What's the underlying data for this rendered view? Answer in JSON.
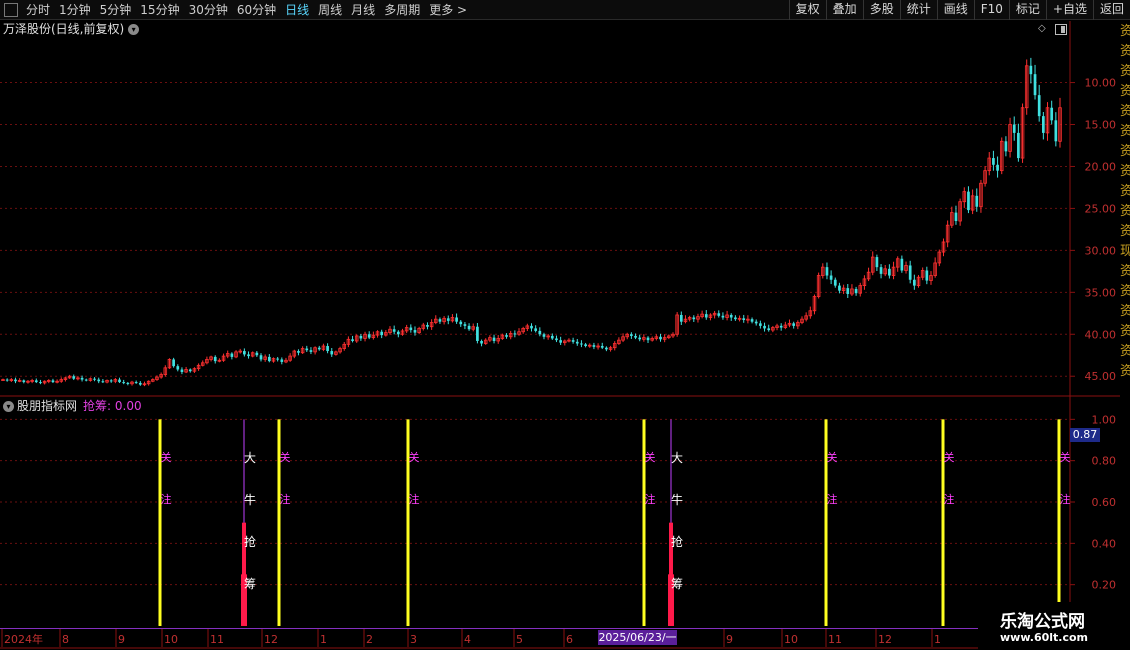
{
  "toolbar": {
    "periods": [
      "分时",
      "1分钟",
      "5分钟",
      "15分钟",
      "30分钟",
      "60分钟",
      "日线",
      "周线",
      "月线",
      "多周期",
      "更多 >"
    ],
    "active_period": "日线",
    "right_tools": [
      "复权",
      "叠加",
      "多股",
      "统计",
      "画线",
      "F10",
      "标记",
      "+自选",
      "返回"
    ]
  },
  "main_chart": {
    "title": "万泽股份(日线,前复权)",
    "price_ticks": [
      "45.00",
      "40.00",
      "35.00",
      "30.00",
      "25.00",
      "20.00",
      "15.00",
      "10.00"
    ],
    "up_color": "#ff3030",
    "down_color": "#40e0e0"
  },
  "right_strip_text": "资资资资资资资资资资资现资资资资资资",
  "indicator": {
    "name": "股朋指标网",
    "value_label": "抢筹: 0.00",
    "ticks": [
      "1.00",
      "0.80",
      "0.60",
      "0.40",
      "0.20"
    ],
    "current_value": "0.87",
    "attention_labels": [
      "关",
      "注"
    ],
    "signal_labels": [
      "大",
      "牛",
      "抢",
      "筹"
    ],
    "yellow_color": "#ffff20",
    "signal_color": "#ff1a4a"
  },
  "time_axis": {
    "labels": [
      "2024年",
      "8",
      "9",
      "10",
      "11",
      "12",
      "1",
      "2",
      "3",
      "4",
      "5",
      "6",
      "9",
      "10",
      "11",
      "12",
      "1"
    ],
    "selected_date": "2025/06/23/一"
  },
  "watermark": {
    "title": "乐淘公式网",
    "url": "www.60lt.com"
  },
  "chart_data": {
    "type": "candlestick",
    "ylim": [
      8,
      49
    ],
    "y_ticks": [
      10,
      15,
      20,
      25,
      30,
      35,
      40,
      45
    ],
    "closes": [
      9.6,
      9.5,
      9.6,
      9.4,
      9.5,
      9.3,
      9.4,
      9.5,
      9.3,
      9.2,
      9.4,
      9.5,
      9.3,
      9.4,
      9.6,
      9.8,
      10.0,
      9.7,
      9.8,
      9.6,
      9.5,
      9.7,
      9.6,
      9.4,
      9.3,
      9.5,
      9.4,
      9.6,
      9.3,
      9.2,
      9.1,
      9.3,
      9.2,
      9.0,
      9.1,
      9.4,
      9.6,
      9.9,
      10.2,
      11.0,
      12.0,
      11.2,
      10.8,
      10.5,
      10.8,
      10.6,
      10.9,
      11.3,
      11.6,
      12.0,
      12.3,
      11.8,
      11.9,
      12.4,
      12.7,
      12.3,
      12.9,
      13.0,
      12.6,
      12.4,
      12.8,
      12.5,
      12.0,
      12.3,
      11.8,
      12.1,
      12.0,
      11.7,
      11.9,
      12.4,
      13.0,
      12.8,
      13.3,
      13.1,
      12.9,
      13.4,
      13.2,
      13.6,
      13.0,
      12.6,
      12.9,
      13.3,
      13.8,
      14.4,
      14.2,
      14.8,
      14.5,
      15.0,
      14.6,
      14.9,
      15.3,
      14.9,
      15.2,
      15.6,
      15.3,
      15.0,
      15.4,
      15.8,
      15.5,
      15.2,
      15.7,
      16.1,
      15.9,
      16.4,
      16.8,
      16.5,
      16.9,
      16.6,
      17.0,
      16.5,
      16.2,
      16.0,
      15.6,
      15.9,
      14.2,
      13.9,
      14.3,
      14.6,
      14.2,
      14.5,
      14.9,
      14.7,
      15.1,
      15.0,
      15.3,
      15.7,
      16.0,
      15.7,
      15.4,
      15.0,
      14.7,
      14.8,
      14.5,
      14.3,
      14.0,
      14.2,
      14.3,
      14.1,
      13.9,
      13.8,
      13.6,
      13.7,
      13.5,
      13.6,
      13.4,
      13.2,
      13.4,
      13.9,
      14.3,
      14.7,
      15.0,
      14.8,
      14.6,
      14.4,
      14.6,
      14.3,
      14.5,
      14.7,
      14.4,
      14.6,
      14.8,
      15.0,
      17.3,
      16.5,
      16.8,
      17.0,
      16.8,
      17.1,
      17.4,
      17.0,
      17.3,
      17.5,
      17.2,
      17.0,
      17.3,
      17.0,
      16.8,
      16.9,
      16.7,
      16.8,
      16.5,
      16.3,
      16.0,
      15.7,
      15.5,
      15.8,
      16.0,
      15.8,
      16.1,
      16.3,
      16.0,
      16.4,
      16.8,
      17.2,
      17.8,
      19.5,
      22.0,
      23.0,
      22.0,
      21.5,
      20.8,
      20.2,
      20.5,
      19.8,
      20.4,
      19.9,
      20.8,
      21.6,
      22.4,
      24.2,
      23.0,
      22.2,
      22.8,
      22.0,
      23.0,
      24.0,
      22.6,
      23.2,
      21.5,
      20.8,
      21.8,
      22.6,
      21.4,
      22.0,
      23.5,
      24.8,
      26.0,
      28.0,
      29.5,
      28.5,
      30.8,
      32.0,
      29.8,
      31.5,
      30.2,
      33.0,
      34.5,
      36.0,
      35.2,
      34.5,
      38.0,
      36.8,
      40.0,
      39.0,
      36.0,
      42.0,
      47.0,
      46.0,
      43.5,
      41.0,
      39.0,
      42.0,
      40.5,
      38.0,
      42.0
    ],
    "indicator_ylim": [
      0,
      1.05
    ],
    "yellow_bar_x": [
      160,
      279,
      408,
      644,
      826,
      943,
      1059
    ],
    "signal_bar_x": [
      244,
      671
    ],
    "signal_bar_value": 0.5,
    "signal_line_value": 1.0
  }
}
